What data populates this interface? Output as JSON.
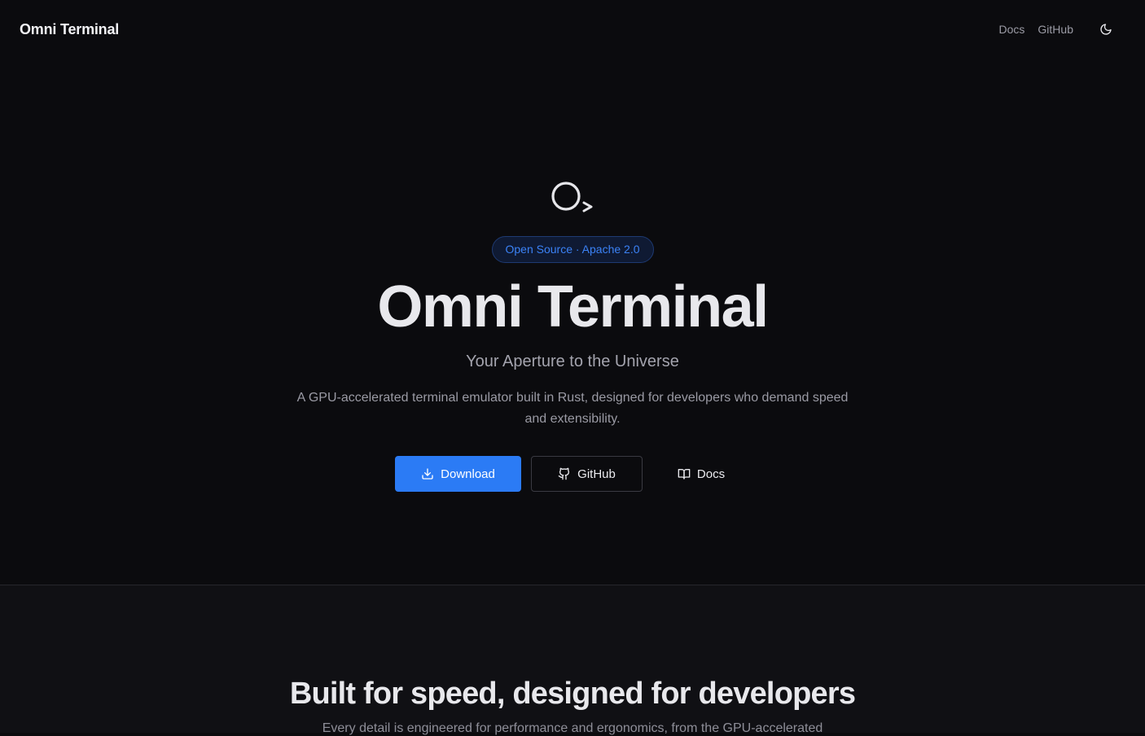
{
  "nav": {
    "brand": "Omni Terminal",
    "links": [
      "Docs",
      "GitHub"
    ],
    "theme_toggle_icon": "moon-icon"
  },
  "hero": {
    "logo_icon": "circle-prompt-logo-icon",
    "badge": "Open Source · Apache 2.0",
    "title": "Omni Terminal",
    "subtitle": "Your Aperture to the Universe",
    "description": "A GPU-accelerated terminal emulator built in Rust, designed for developers who demand speed and extensibility.",
    "buttons": {
      "download": "Download",
      "github": "GitHub",
      "docs": "Docs"
    }
  },
  "features": {
    "title": "Built for speed, designed for developers",
    "description": "Every detail is engineered for performance and ergonomics, from the GPU-accelerated"
  },
  "colors": {
    "background": "#0b0b0e",
    "accent": "#2b7bf5",
    "badge_text": "#3b82f6"
  }
}
